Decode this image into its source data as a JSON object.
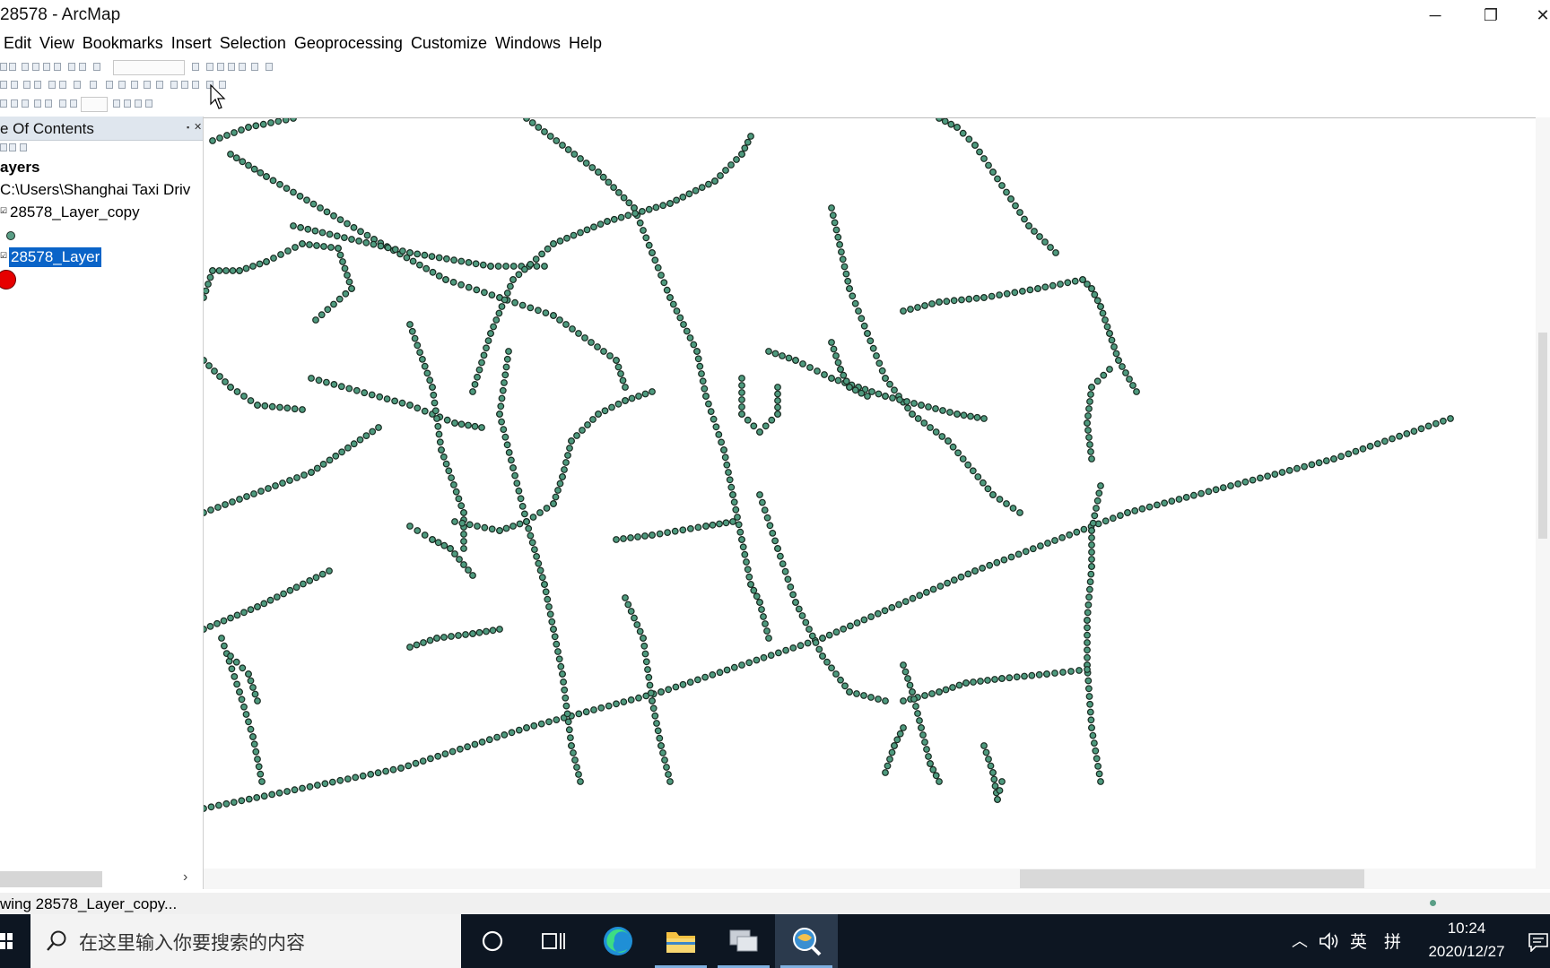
{
  "window": {
    "title": "28578 - ArcMap",
    "minimize_label": "─",
    "restore_label": "❐",
    "close_label": "✕"
  },
  "menu": [
    "Edit",
    "View",
    "Bookmarks",
    "Insert",
    "Selection",
    "Geoprocessing",
    "Customize",
    "Windows",
    "Help"
  ],
  "toc": {
    "title": "e Of Contents",
    "group_label": "ayers",
    "path_label": "C:\\Users\\Shanghai Taxi Driv",
    "layers": [
      {
        "name": "28578_Layer_copy",
        "checked": true,
        "selected": false,
        "symbol_color": "#5a9e86"
      },
      {
        "name": "28578_Layer",
        "checked": true,
        "selected": true,
        "symbol_color": "#e60000"
      }
    ]
  },
  "map": {
    "point_fill": "#4e9a7e",
    "point_stroke": "#1a2b22",
    "background": "#ffffff"
  },
  "status": {
    "text": "wing 28578_Layer_copy..."
  },
  "taskbar": {
    "search_placeholder": "在这里输入你要搜索的内容",
    "tray_ime": "英",
    "tray_ime2": "拼",
    "time": "10:24",
    "date": "2020/12/27"
  },
  "colors": {
    "selection": "#0a64c8",
    "taskbar": "#0d1622",
    "toc_header": "#dfe6ee"
  }
}
